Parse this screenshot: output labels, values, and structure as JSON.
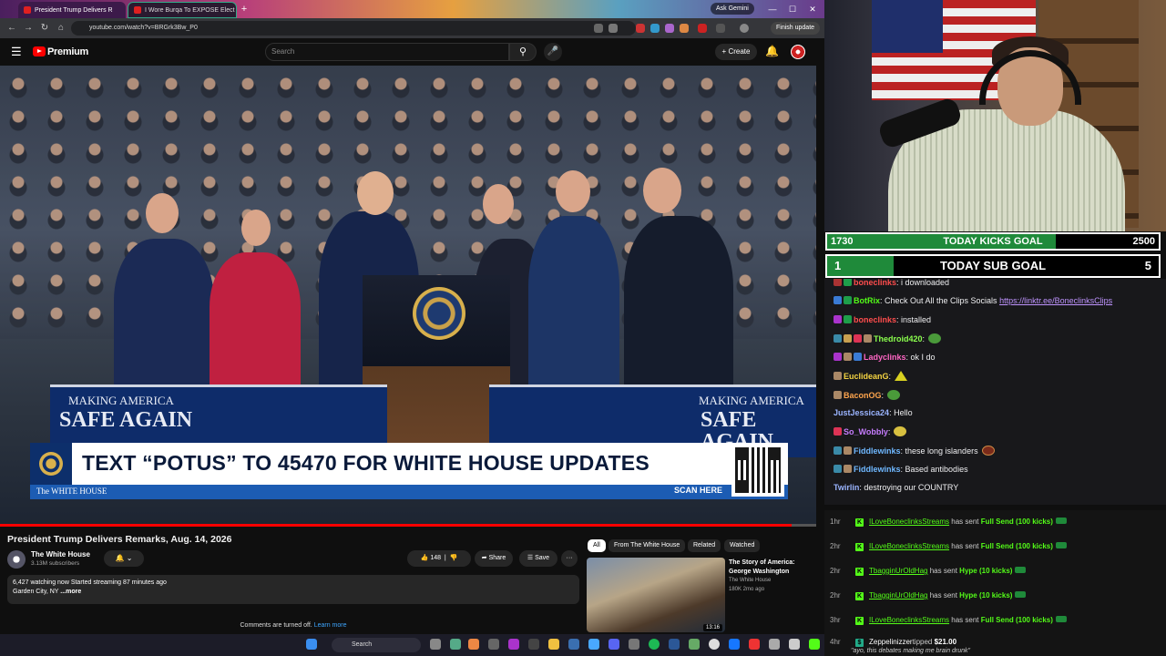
{
  "browser": {
    "tabs": [
      {
        "label": "President Trump Delivers R"
      },
      {
        "label": "I Wore Burqa To EXPOSE Elect"
      }
    ],
    "new_tab": "+",
    "ask_gemini": "Ask Gemini",
    "url": "youtube.com/watch?v=BRGrk3Bw_P0",
    "finish_update": "Finish update",
    "window_controls": [
      "—",
      "☐",
      "✕"
    ]
  },
  "youtube": {
    "brand": "Premium",
    "search_placeholder": "Search",
    "create_label": "+ Create",
    "video": {
      "banner_left_line1": "MAKING AMERICA",
      "banner_left_line2": "SAFE AGAIN",
      "banner_right_line1": "MAKING AMERICA",
      "banner_right_line2": "SAFE AGAIN",
      "lower_third": "TEXT “POTUS” TO 45470 FOR WHITE HOUSE UPDATES",
      "lower_third_source": "The WHITE HOUSE",
      "scan_here": "SCAN HERE",
      "progress": 0.97
    },
    "title": "President Trump Delivers Remarks, Aug. 14, 2026",
    "channel": {
      "name": "The White House",
      "subscribers": "3.13M subscribers"
    },
    "actions": {
      "likes": "148",
      "share": "Share",
      "save": "Save",
      "more": "···"
    },
    "description": {
      "line1": "6,427 watching now  Started streaming 87 minutes ago",
      "line2": "Garden City, NY ",
      "more": "...more"
    },
    "comments_off": "Comments are turned off. ",
    "learn_more": "Learn more",
    "chips": [
      "All",
      "From The White House",
      "Related",
      "Watched"
    ],
    "recommended": {
      "title": "The Story of America: George Washington",
      "channel": "The White House",
      "meta": "180K  2mo ago",
      "duration": "13:16"
    }
  },
  "taskbar": {
    "search_placeholder": "Search"
  },
  "overlay": {
    "kicks_goal": {
      "current": "1730",
      "label": "TODAY KICKS GOAL",
      "target": "2500",
      "fill": 0.69
    },
    "sub_goal": {
      "current": "1",
      "label": "TODAY SUB GOAL",
      "target": "5",
      "fill": 0.2
    }
  },
  "chat": [
    {
      "user": "boneclinks",
      "color": "#ff4d4d",
      "text": ": i downloaded"
    },
    {
      "user": "BotRix",
      "color": "#53fc18",
      "text": ": Check Out All the Clips Socials ",
      "link": "https://linktr.ee/BoneclinksClips"
    },
    {
      "user": "boneclinks",
      "color": "#ff4d4d",
      "text": ": installed"
    },
    {
      "user": "Thedroid420",
      "color": "#8aff4d",
      "text": ":"
    },
    {
      "user": "Ladyclinks",
      "color": "#ff66c4",
      "text": ": ok I do"
    },
    {
      "user": "EuclideanG",
      "color": "#f5d442",
      "text": ":"
    },
    {
      "user": "BaconOG",
      "color": "#ffa54d",
      "text": ":"
    },
    {
      "user": "JustJessica24",
      "color": "#9ab4ff",
      "text": ": Hello"
    },
    {
      "user": "So_Wobbly",
      "color": "#c77dff",
      "text": ":"
    },
    {
      "user": "Fiddlewinks",
      "color": "#6fb8ff",
      "text": ": these long islanders"
    },
    {
      "user": "Fiddlewinks",
      "color": "#6fb8ff",
      "text": ": Based antibodies"
    },
    {
      "user": "Twirlin",
      "color": "#9ab4ff",
      "text": ": destroying our COUNTRY"
    }
  ],
  "feed": [
    {
      "time": "1hr",
      "user": "ILoveBoneclinksStreams",
      "sent": " has sent ",
      "gift": "Full Send (100 kicks)"
    },
    {
      "time": "2hr",
      "user": "ILoveBoneclinksStreams",
      "sent": " has sent ",
      "gift": "Full Send (100 kicks)"
    },
    {
      "time": "2hr",
      "user": "TbagginUrOldHag",
      "sent": " has sent ",
      "gift": "Hype (10 kicks)"
    },
    {
      "time": "2hr",
      "user": "TbagginUrOldHag",
      "sent": " has sent ",
      "gift": "Hype (10 kicks)"
    },
    {
      "time": "3hr",
      "user": "ILoveBoneclinksStreams",
      "sent": " has sent ",
      "gift": "Full Send (100 kicks)"
    }
  ],
  "tip": {
    "time": "4hr",
    "user": "Zeppelinizzer",
    "text": "tipped ",
    "amount": "$21.00",
    "message": "\"ayo, this debates making me brain drunk\""
  },
  "colors": {
    "youtube_red": "#ff0000",
    "kick_green": "#53fc18",
    "goal_fill": "#1f8a3a"
  }
}
